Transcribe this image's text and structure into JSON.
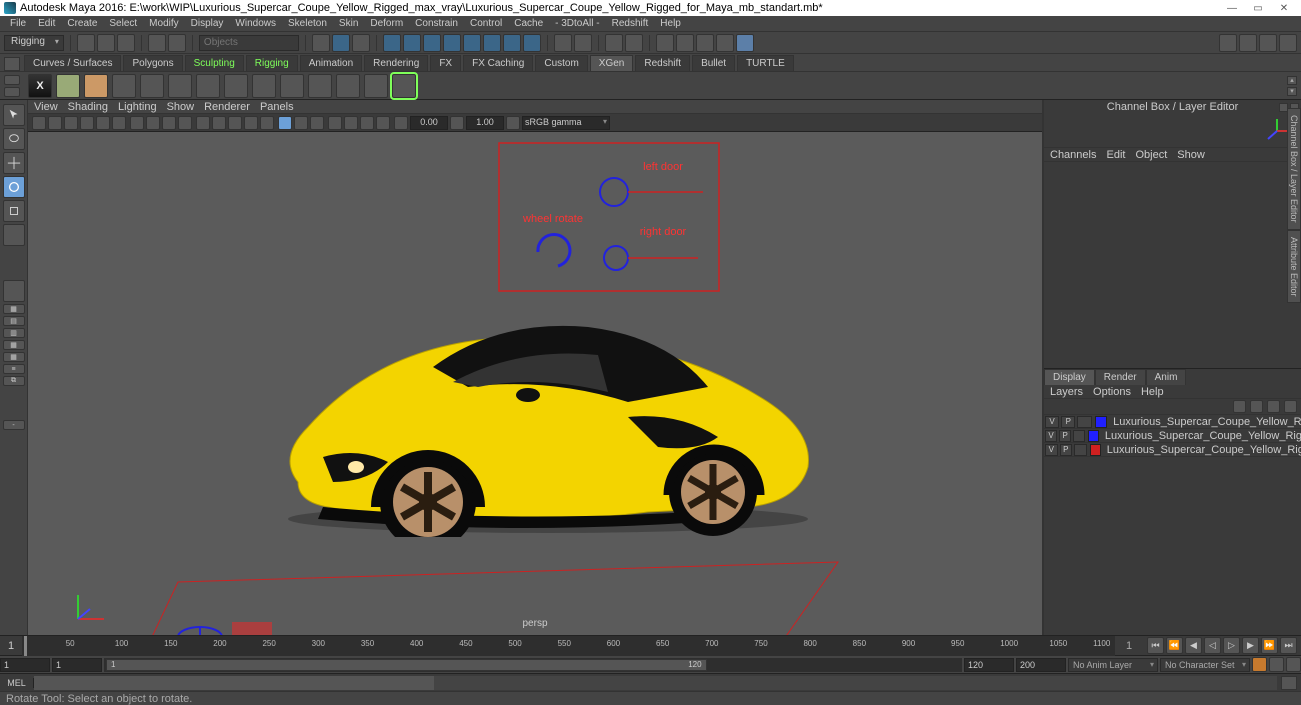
{
  "title": "Autodesk Maya 2016: E:\\work\\WIP\\Luxurious_Supercar_Coupe_Yellow_Rigged_max_vray\\Luxurious_Supercar_Coupe_Yellow_Rigged_for_Maya_mb_standart.mb*",
  "menu": [
    "File",
    "Edit",
    "Create",
    "Select",
    "Modify",
    "Display",
    "Windows",
    "Skeleton",
    "Skin",
    "Deform",
    "Constrain",
    "Control",
    "Cache",
    "- 3DtoAll -",
    "Redshift",
    "Help"
  ],
  "workspace_dropdown": "Rigging",
  "search_placeholder": "Objects",
  "shelf_tabs": [
    "Curves / Surfaces",
    "Polygons",
    "Sculpting",
    "Rigging",
    "Animation",
    "Rendering",
    "FX",
    "FX Caching",
    "Custom",
    "XGen",
    "Redshift",
    "Bullet",
    "TURTLE"
  ],
  "shelf_selected": "XGen",
  "viewport_menu": [
    "View",
    "Shading",
    "Lighting",
    "Show",
    "Renderer",
    "Panels"
  ],
  "viewport_exposure": "0.00",
  "viewport_gamma_val": "1.00",
  "viewport_color_space": "sRGB gamma",
  "viewport_camera": "persp",
  "rig_labels": {
    "left_door": "left door",
    "right_door": "right door",
    "wheel_rotate": "wheel rotate"
  },
  "channel_box_title": "Channel Box / Layer Editor",
  "channel_menu": [
    "Channels",
    "Edit",
    "Object",
    "Show"
  ],
  "layer_tabs": [
    "Display",
    "Render",
    "Anim"
  ],
  "layer_tab_selected": "Display",
  "layer_opts": [
    "Layers",
    "Options",
    "Help"
  ],
  "layers": [
    {
      "v": "V",
      "p": "P",
      "color": "#2020ff",
      "name": "Luxurious_Supercar_Coupe_Yellow_Rigged"
    },
    {
      "v": "V",
      "p": "P",
      "color": "#2020ff",
      "name": "Luxurious_Supercar_Coupe_Yellow_Rigged_controllers"
    },
    {
      "v": "V",
      "p": "P",
      "color": "#d02020",
      "name": "Luxurious_Supercar_Coupe_Yellow_Rigged_helpers"
    }
  ],
  "side_tabs": [
    "Channel Box / Layer Editor",
    "Attribute Editor"
  ],
  "timeline": {
    "current": "1",
    "marks": [
      "50",
      "100",
      "150",
      "200",
      "250",
      "300",
      "350",
      "400",
      "450",
      "500",
      "550",
      "600",
      "650",
      "700",
      "750",
      "800",
      "850",
      "900",
      "950",
      "1000",
      "1050",
      "1100"
    ],
    "end": "1"
  },
  "range": {
    "start": "1",
    "in": "1",
    "in_bar": "1",
    "out_bar": "120",
    "out": "120",
    "end": "200"
  },
  "anim_layer_dd": "No Anim Layer",
  "char_set_dd": "No Character Set",
  "cmd_lang": "MEL",
  "status_text": "Rotate Tool: Select an object to rotate."
}
